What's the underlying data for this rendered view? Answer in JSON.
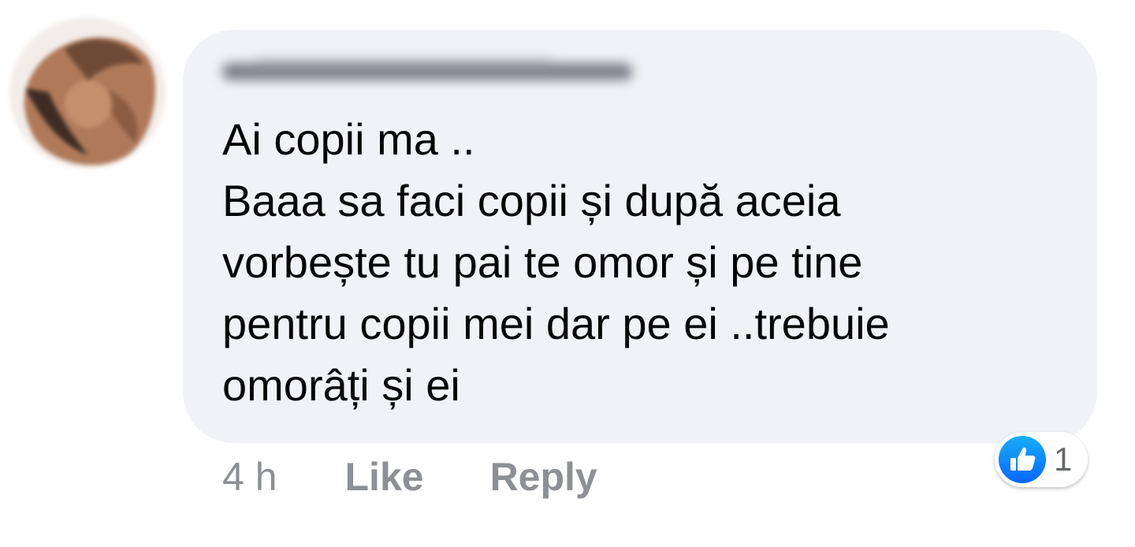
{
  "comment": {
    "text": "Ai copii ma ..\nBaaa sa faci copii și după aceia\nvorbește tu pai te omor și pe tine\npentru copii mei dar pe ei ..trebuie\nomorâți și ei",
    "timestamp": "4 h",
    "like_label": "Like",
    "reply_label": "Reply",
    "reaction_count": "1",
    "reaction_icon": "thumbs-up-icon"
  },
  "colors": {
    "bubble_bg": "#f0f2f5",
    "text": "#050505",
    "meta_text": "#8d9094",
    "like_blue": "#1877f2"
  }
}
